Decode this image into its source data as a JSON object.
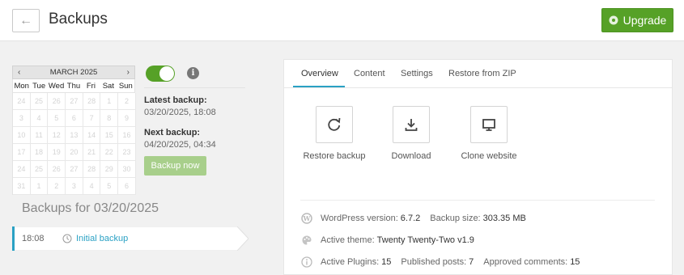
{
  "header": {
    "back_icon": "arrow-left-icon",
    "title": "Backups",
    "upgrade_label": "Upgrade",
    "upgrade_icon": "gear-icon",
    "upgrade_color": "#56a127"
  },
  "calendar": {
    "month_label": "MARCH 2025",
    "prev": "‹",
    "next": "›",
    "weekdays": [
      "Mon",
      "Tue",
      "Wed",
      "Thu",
      "Fri",
      "Sat",
      "Sun"
    ],
    "days": [
      "24",
      "25",
      "26",
      "27",
      "28",
      "1",
      "2",
      "3",
      "4",
      "5",
      "6",
      "7",
      "8",
      "9",
      "10",
      "11",
      "12",
      "13",
      "14",
      "15",
      "16",
      "17",
      "18",
      "19",
      "20",
      "21",
      "22",
      "23",
      "24",
      "25",
      "26",
      "27",
      "28",
      "29",
      "30",
      "31",
      "1",
      "2",
      "3",
      "4",
      "5",
      "6"
    ],
    "selected_day": "20"
  },
  "schedule": {
    "toggle_on": true,
    "latest_label": "Latest backup:",
    "latest_value": "03/20/2025, 18:08",
    "next_label": "Next backup:",
    "next_value": "04/20/2025, 04:34",
    "backup_now_label": "Backup now"
  },
  "backups": {
    "heading": "Backups for 03/20/2025",
    "items": [
      {
        "time": "18:08",
        "name": "Initial backup"
      }
    ]
  },
  "panel": {
    "tabs": [
      "Overview",
      "Content",
      "Settings",
      "Restore from ZIP"
    ],
    "active_tab": "Overview",
    "actions": [
      {
        "icon": "restore-icon",
        "label": "Restore backup"
      },
      {
        "icon": "download-icon",
        "label": "Download"
      },
      {
        "icon": "monitor-icon",
        "label": "Clone website"
      }
    ],
    "info": {
      "wp_version_label": "WordPress version:",
      "wp_version": "6.7.2",
      "backup_size_label": "Backup size:",
      "backup_size": "303.35 MB",
      "theme_label": "Active theme:",
      "theme": "Twenty Twenty-Two v1.9",
      "plugins_label": "Active Plugins:",
      "plugins": "15",
      "posts_label": "Published posts:",
      "posts": "7",
      "comments_label": "Approved comments:",
      "comments": "15"
    }
  },
  "colors": {
    "accent_green": "#56a127",
    "link_blue": "#2aa1c4"
  }
}
